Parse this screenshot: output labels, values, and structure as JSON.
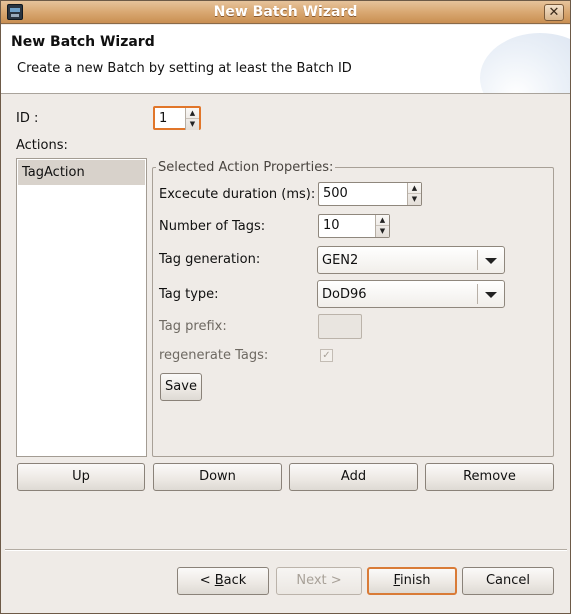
{
  "window": {
    "title": "New Batch Wizard",
    "close_glyph": "✕"
  },
  "header": {
    "title": "New Batch Wizard",
    "description": "Create a new Batch by setting at least the Batch ID"
  },
  "id_field": {
    "label": "ID :",
    "value": "1"
  },
  "actions": {
    "label": "Actions:",
    "items": [
      "TagAction"
    ]
  },
  "properties": {
    "group_title": "Selected Action Properties:",
    "execute_duration_label": "Excecute duration (ms):",
    "execute_duration_value": "500",
    "number_of_tags_label": "Number of Tags:",
    "number_of_tags_value": "10",
    "tag_generation_label": "Tag generation:",
    "tag_generation_value": "GEN2",
    "tag_type_label": "Tag type:",
    "tag_type_value": "DoD96",
    "tag_prefix_label": "Tag prefix:",
    "tag_prefix_value": "",
    "regenerate_label": "regenerate Tags:",
    "regenerate_checked": true,
    "save_label": "Save"
  },
  "list_buttons": {
    "up": "Up",
    "down": "Down",
    "add": "Add",
    "remove": "Remove"
  },
  "footer": {
    "back_prefix": "< ",
    "back_mnemonic": "B",
    "back_rest": "ack",
    "next_label": "Next >",
    "finish_mnemonic": "F",
    "finish_rest": "inish",
    "cancel_label": "Cancel"
  },
  "colors": {
    "titlebar": "#d9a872",
    "focus_accent": "#e1762a",
    "window_bg": "#efebe7"
  }
}
